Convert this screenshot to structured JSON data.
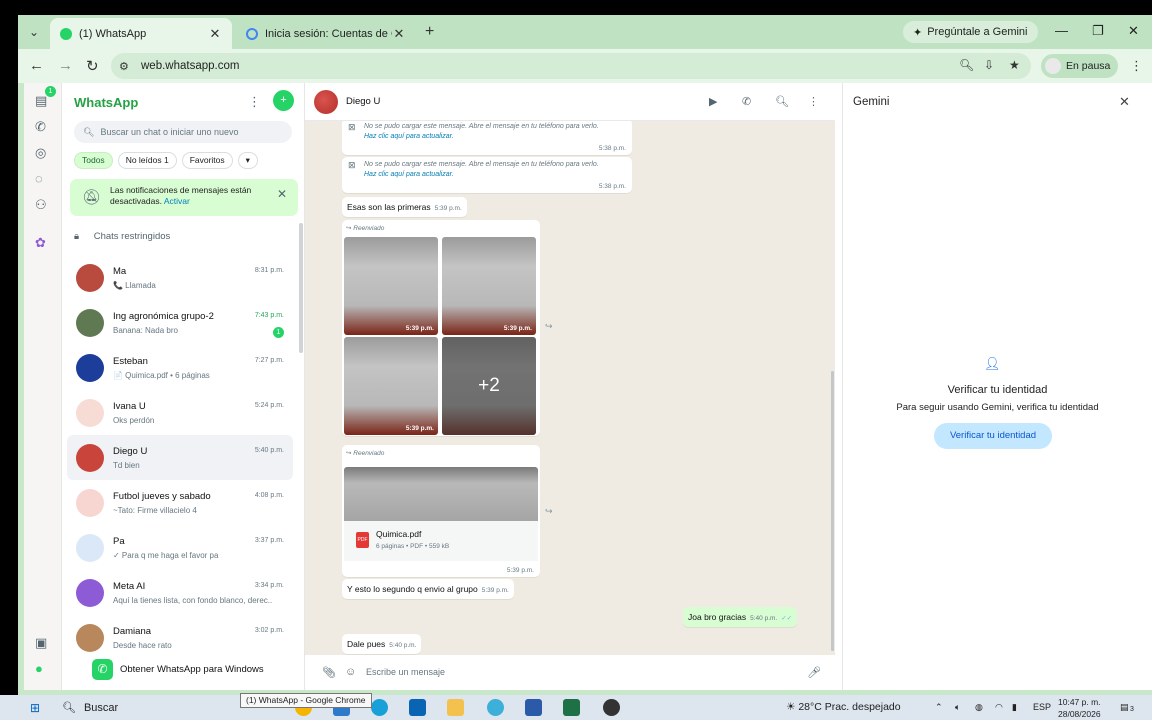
{
  "browser": {
    "tabs": [
      {
        "label": "(1) WhatsApp",
        "active": true
      },
      {
        "label": "Inicia sesión: Cuentas de Google",
        "active": false
      }
    ],
    "gemini_button": "Pregúntale a Gemini",
    "url": "web.whatsapp.com",
    "profile_status": "En pausa",
    "tooltip": "(1) WhatsApp - Google Chrome"
  },
  "rail": {
    "chats_badge": "1"
  },
  "sidebar": {
    "title": "WhatsApp",
    "search_placeholder": "Buscar un chat o iniciar uno nuevo",
    "filters": [
      "Todos",
      "No leídos 1",
      "Favoritos",
      "▾"
    ],
    "notification": {
      "text": "Las notificaciones de mensajes están desactivadas.",
      "link": "Activar"
    },
    "restricted": "Chats restringidos",
    "chats": [
      {
        "name": "Ma",
        "message": "📞 Llamada",
        "time": "8:31 p.m.",
        "unread": "",
        "avatar": "#b84a3e"
      },
      {
        "name": "Ing agronómica grupo-2",
        "message": "Banana: Nada bro",
        "time": "7:43 p.m.",
        "unread": "1",
        "avatar": "#5f7a52"
      },
      {
        "name": "Esteban",
        "message": "📄 Quimica.pdf • 6 páginas",
        "time": "7:27 p.m.",
        "unread": "",
        "avatar": "#1d3d9b"
      },
      {
        "name": "Ivana U",
        "message": "Oks perdón",
        "time": "5:24 p.m.",
        "unread": "",
        "avatar": "#f7dcd5"
      },
      {
        "name": "Diego U",
        "message": "Td bien",
        "time": "5:40 p.m.",
        "unread": "",
        "avatar": "#c9453b"
      },
      {
        "name": "Futbol jueves y sabado",
        "message": "~Tato: Firme villacielo 4",
        "time": "4:08 p.m.",
        "unread": "",
        "avatar": "#f7d6d2"
      },
      {
        "name": "Pa",
        "message": "✓ Para q me haga el favor pa",
        "time": "3:37 p.m.",
        "unread": "",
        "avatar": "#dbe8f7"
      },
      {
        "name": "Meta AI",
        "message": "Aquí la tienes lista, con fondo blanco, derec...",
        "time": "3:34 p.m.",
        "unread": "",
        "avatar": "#8e5bd6"
      },
      {
        "name": "Damiana",
        "message": "Desde hace rato",
        "time": "3:02 p.m.",
        "unread": "",
        "avatar": "#b8875c"
      }
    ],
    "get_windows": "Obtener WhatsApp para Windows"
  },
  "chat": {
    "contact": "Diego U",
    "system_msg_1": "No se pudo cargar este mensaje. Abre el mensaje en tu teléfono para verlo.",
    "system_link": "Haz clic aquí para actualizar.",
    "system_time_1": "5:38 p.m.",
    "system_time_2": "5:38 p.m.",
    "msg_first": "Esas son las primeras",
    "msg_first_time": "5:39 p.m.",
    "forwarded": "Reenviado",
    "photo_time": "5:39 p.m.",
    "photo_more": "+2",
    "doc_name": "Quimica.pdf",
    "doc_meta": "6 páginas • PDF • 559 kB",
    "pdf_label": "PDF",
    "doc_time": "5:39 p.m.",
    "msg_group": "Y esto lo segundo q envio al grupo",
    "msg_group_time": "5:39 p.m.",
    "msg_out": "Joa bro gracias",
    "msg_out_time": "5:40 p.m.",
    "msg_last": "Dale pues",
    "msg_last_time": "5:40 p.m.",
    "composer_placeholder": "Escribe un mensaje"
  },
  "gemini": {
    "title": "Gemini",
    "heading": "Verificar tu identidad",
    "subtext": "Para seguir usando Gemini, verifica tu identidad",
    "button": "Verificar tu identidad"
  },
  "taskbar": {
    "search": "Buscar",
    "weather": "28°C  Prac. despejado",
    "lang": "ESP",
    "time": "10:47 p. m.",
    "date": "28/08/2026",
    "notif_count": "3"
  }
}
